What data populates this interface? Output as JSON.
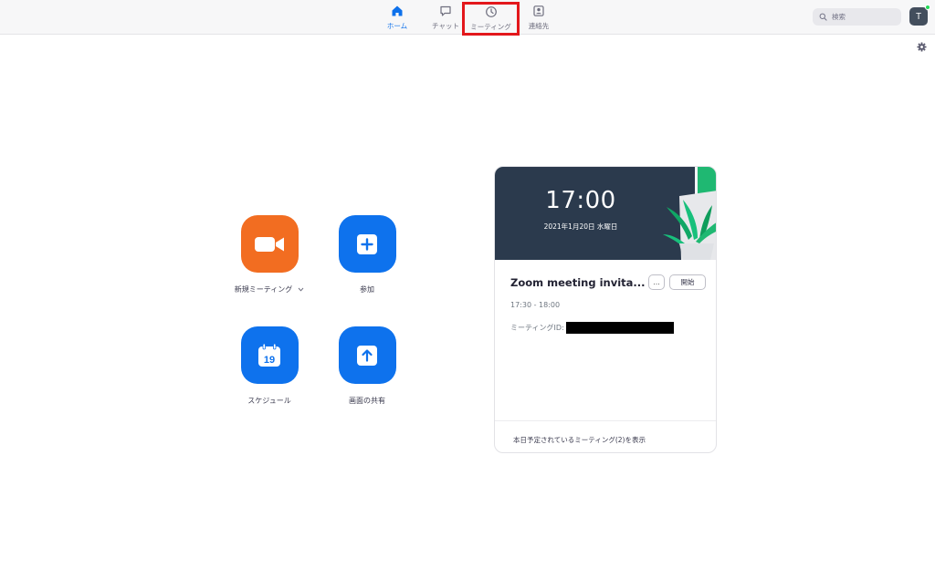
{
  "nav": {
    "tabs": [
      {
        "label": "ホーム",
        "icon": "home-icon",
        "active": true
      },
      {
        "label": "チャット",
        "icon": "chat-icon",
        "active": false
      },
      {
        "label": "ミーティング",
        "icon": "clock-icon",
        "active": false,
        "highlighted": true
      },
      {
        "label": "連絡先",
        "icon": "contacts-icon",
        "active": false
      }
    ]
  },
  "search": {
    "placeholder": "検索"
  },
  "user": {
    "initial": "T",
    "status_color": "#23d959"
  },
  "actions": {
    "new_meeting": {
      "label": "新規ミーティング",
      "icon": "video-camera-icon",
      "color": "#f26d21"
    },
    "join": {
      "label": "参加",
      "icon": "plus-icon",
      "color": "#0e72ed"
    },
    "schedule": {
      "label": "スケジュール",
      "icon": "calendar-icon",
      "day": "19",
      "color": "#0e72ed"
    },
    "share_screen": {
      "label": "画面の共有",
      "icon": "share-arrow-icon",
      "color": "#0e72ed"
    }
  },
  "meeting_card": {
    "time": "17:00",
    "date": "2021年1月20日 水曜日",
    "title": "Zoom meeting invita...",
    "more_label": "...",
    "start_label": "開始",
    "time_range": "17:30 - 18:00",
    "id_label": "ミーティングID:",
    "footer_link": "本日予定されているミーティング(2)を表示"
  },
  "colors": {
    "accent": "#0e71eb",
    "highlight_border": "#e3171b",
    "header_bg": "#2b3a4d"
  }
}
